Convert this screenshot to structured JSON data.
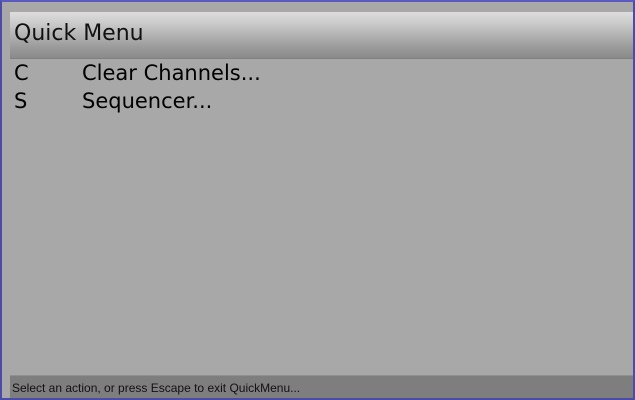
{
  "menu": {
    "title": "Quick Menu",
    "items": [
      {
        "key": "C",
        "label": "Clear Channels..."
      },
      {
        "key": "S",
        "label": "Sequencer..."
      }
    ]
  },
  "status": {
    "text": "Select an action, or press Escape to exit QuickMenu..."
  },
  "colors": {
    "border": "#4b4ba8",
    "background": "#a8a8a8",
    "status_bar": "#7e7e7e"
  }
}
